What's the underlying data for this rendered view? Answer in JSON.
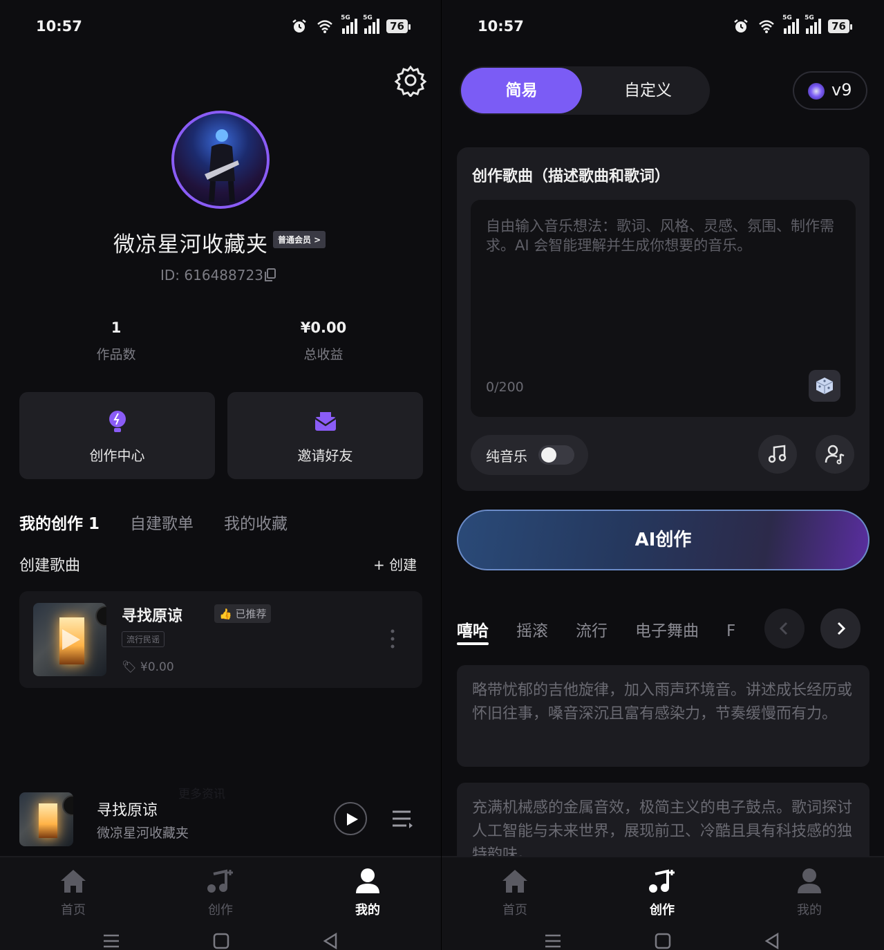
{
  "left": {
    "status": {
      "time": "10:57",
      "battery": "76",
      "net": "5G"
    },
    "profile": {
      "username": "微凉星河收藏夹",
      "member_badge": "普通会员 >",
      "user_id": "ID: 616488723"
    },
    "stats": [
      {
        "value": "1",
        "label": "作品数"
      },
      {
        "value": "¥0.00",
        "label": "总收益"
      }
    ],
    "actions": [
      {
        "label": "创作中心"
      },
      {
        "label": "邀请好友"
      }
    ],
    "tabs": [
      {
        "label": "我的创作 1"
      },
      {
        "label": "自建歌单"
      },
      {
        "label": "我的收藏"
      }
    ],
    "section": {
      "title": "创建歌曲",
      "create": "+ 创建"
    },
    "song": {
      "title": "寻找原谅",
      "badge": "已推荐",
      "tag": "流行民谣",
      "price": "¥0.00"
    },
    "mini_player": {
      "title": "寻找原谅",
      "artist": "微凉星河收藏夹",
      "ghost": "更多资讯"
    },
    "nav": [
      {
        "label": "首页"
      },
      {
        "label": "创作"
      },
      {
        "label": "我的"
      }
    ]
  },
  "right": {
    "status": {
      "time": "10:57",
      "battery": "76",
      "net": "5G"
    },
    "mode": {
      "simple": "简易",
      "custom": "自定义"
    },
    "version": "v9",
    "compose": {
      "title": "创作歌曲（描述歌曲和歌词）",
      "placeholder": "自由输入音乐想法：歌词、风格、灵感、氛围、制作需求。AI 会智能理解并生成你想要的音乐。",
      "count": "0/200",
      "pure_music": "纯音乐"
    },
    "ai_button": "AI创作",
    "genres": [
      "嘻哈",
      "摇滚",
      "流行",
      "电子舞曲",
      "F"
    ],
    "inspirations": [
      "略带忧郁的吉他旋律，加入雨声环境音。讲述成长经历或怀旧往事，嗓音深沉且富有感染力，节奏缓慢而有力。",
      "充满机械感的金属音效，极简主义的电子鼓点。歌词探讨人工智能与未来世界，展现前卫、冷酷且具有科技感的独特韵味。"
    ],
    "nav": [
      {
        "label": "首页"
      },
      {
        "label": "创作"
      },
      {
        "label": "我的"
      }
    ]
  },
  "colors": {
    "accent": "#7b5cf5",
    "background": "#0d0d10",
    "card": "#1c1c21"
  },
  "icons": [
    "alarm-icon",
    "wifi-icon",
    "signal-icon",
    "battery-icon",
    "gear-icon",
    "copy-icon",
    "bulb-icon",
    "mail-icon",
    "thumb-icon",
    "more-icon",
    "play-icon",
    "playlist-icon",
    "home-icon",
    "music-note-icon",
    "user-icon",
    "dice-icon",
    "singer-icon",
    "chevron-left-icon",
    "chevron-right-icon"
  ]
}
